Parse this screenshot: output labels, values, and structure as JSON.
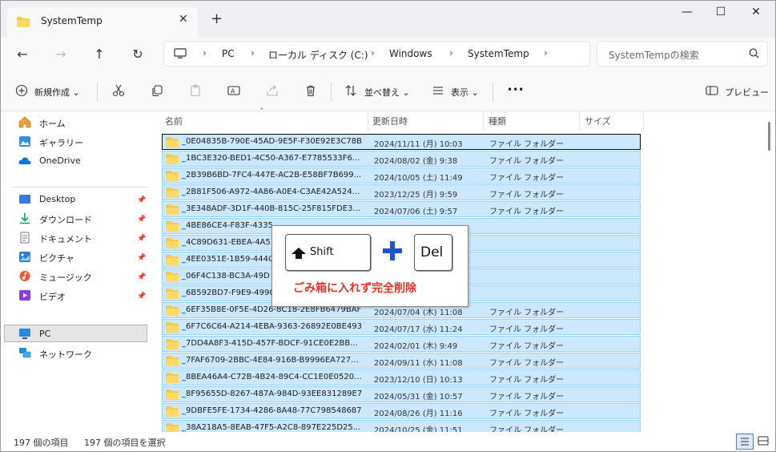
{
  "tab": {
    "title": "SystemTemp",
    "close": "✕",
    "new": "+"
  },
  "window_controls": {
    "minimize": "—",
    "maximize": "☐",
    "close": "✕"
  },
  "breadcrumb": [
    "PC",
    "ローカル ディスク (C:)",
    "Windows",
    "SystemTemp"
  ],
  "search": {
    "placeholder": "SystemTempの検索"
  },
  "toolbar": {
    "new_label": "新規作成",
    "sort_label": "並べ替え",
    "view_label": "表示",
    "more_label": "•••",
    "preview_label": "プレビュー"
  },
  "sidebar": {
    "items": [
      {
        "label": "ホーム",
        "icon": "home-icon",
        "pinned": false
      },
      {
        "label": "ギャラリー",
        "icon": "gallery-icon",
        "pinned": false
      },
      {
        "label": "OneDrive",
        "icon": "cloud-icon",
        "pinned": false
      },
      {
        "label": "Desktop",
        "icon": "desktop-icon",
        "pinned": true
      },
      {
        "label": "ダウンロード",
        "icon": "download-icon",
        "pinned": true
      },
      {
        "label": "ドキュメント",
        "icon": "document-icon",
        "pinned": true
      },
      {
        "label": "ピクチャ",
        "icon": "picture-icon",
        "pinned": true
      },
      {
        "label": "ミュージック",
        "icon": "music-icon",
        "pinned": true
      },
      {
        "label": "ビデオ",
        "icon": "video-icon",
        "pinned": true
      },
      {
        "label": "PC",
        "icon": "pc-icon",
        "pinned": false,
        "selected": true
      },
      {
        "label": "ネットワーク",
        "icon": "network-icon",
        "pinned": false
      }
    ]
  },
  "columns": [
    "名前",
    "更新日時",
    "種類",
    "サイズ"
  ],
  "files": [
    {
      "name": "_0E04835B-790E-45AD-9E5F-F30E92E3C78B",
      "date": "2024/11/11 (月) 10:03",
      "type": "ファイル フォルダー"
    },
    {
      "name": "_1BC3E320-BED1-4C50-A367-E7785533F6...",
      "date": "2024/08/02 (金) 9:38",
      "type": "ファイル フォルダー"
    },
    {
      "name": "_2B39B6BD-7FC4-447E-AC2B-E58BF7B699...",
      "date": "2024/10/05 (土) 11:49",
      "type": "ファイル フォルダー"
    },
    {
      "name": "_2B81F506-A972-4A86-A0E4-C3AE42A524...",
      "date": "2023/12/25 (月) 9:59",
      "type": "ファイル フォルダー"
    },
    {
      "name": "_3E348ADF-3D1F-440B-815C-25F815FDE3...",
      "date": "2024/07/06 (土) 9:57",
      "type": "ファイル フォルダー"
    },
    {
      "name": "_4BE86CE4-F83F-4335",
      "date": "",
      "type": ""
    },
    {
      "name": "_4C89D631-EBEA-4A5",
      "date": "",
      "type": ""
    },
    {
      "name": "_4EE0351E-1B59-444C",
      "date": "",
      "type": ""
    },
    {
      "name": "_06F4C138-BC3A-49D",
      "date": "",
      "type": ""
    },
    {
      "name": "_6B592BD7-F9E9-4990",
      "date": "",
      "type": ""
    },
    {
      "name": "_6EF35B8E-0F5E-4D26-8C18-2E8FB6479BAF",
      "date": "2024/07/04 (木) 11:08",
      "type": "ファイル フォルダー"
    },
    {
      "name": "_6F7C6C64-A214-4EBA-9363-26892E0BE493",
      "date": "2024/07/17 (水) 11:24",
      "type": "ファイル フォルダー"
    },
    {
      "name": "_7DD4A8F3-415D-457F-BDCF-91CE0E2BB...",
      "date": "2024/02/01 (木) 9:49",
      "type": "ファイル フォルダー"
    },
    {
      "name": "_7FAF6709-2BBC-4E84-916B-B9996EA727...",
      "date": "2024/09/11 (水) 11:08",
      "type": "ファイル フォルダー"
    },
    {
      "name": "_8BEA46A4-C72B-4B24-89C4-CC1E0E0520...",
      "date": "2023/12/10 (日) 10:13",
      "type": "ファイル フォルダー"
    },
    {
      "name": "_8F95655D-8267-487A-984D-93EE831289E7",
      "date": "2024/05/31 (金) 10:57",
      "type": "ファイル フォルダー"
    },
    {
      "name": "_9DBFE5FE-1734-4286-8A48-77C798548687",
      "date": "2024/08/26 (月) 11:16",
      "type": "ファイル フォルダー"
    },
    {
      "name": "_38A218A5-8EAB-47F5-A2C8-897E225D25...",
      "date": "2024/10/25 (金) 11:51",
      "type": "ファイル フォルダー"
    }
  ],
  "status": {
    "count": "197 個の項目",
    "selected": "197 個の項目を選択"
  },
  "overlay": {
    "shift_key": "Shift",
    "del_key": "Del",
    "caption": "ごみ箱に入れず完全削除"
  },
  "colors": {
    "selection": "#cce8ff",
    "selection_border": "#99d1ff",
    "folder": "#f7c948",
    "caption": "#e3322a",
    "plus": "#1a56c8"
  }
}
